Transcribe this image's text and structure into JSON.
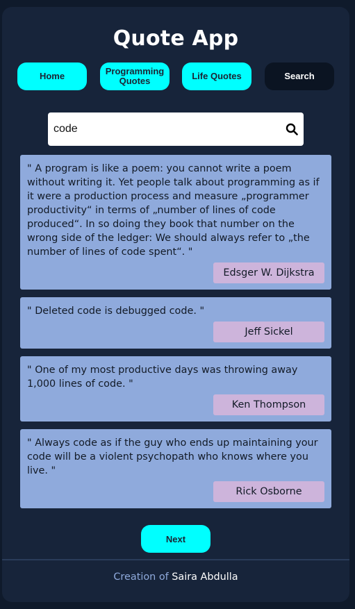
{
  "app": {
    "title": "Quote App"
  },
  "nav": {
    "items": [
      {
        "label": "Home"
      },
      {
        "label": "Programming\nQuotes"
      },
      {
        "label": "Life Quotes"
      },
      {
        "label": "Search"
      }
    ]
  },
  "search": {
    "value": "code",
    "placeholder": ""
  },
  "quotes": [
    {
      "text": "\" A program is like a poem: you cannot write a poem without writing it. Yet people talk about programming as if it were a production process and measure „programmer productivity“ in terms of „number of lines of code produced“. In so doing they book that number on the wrong side of the ledger: We should always refer to „the number of lines of code spent“. \"",
      "author": "Edsger W. Dijkstra"
    },
    {
      "text": "\" Deleted code is debugged code. \"",
      "author": "Jeff Sickel"
    },
    {
      "text": "\" One of my most productive days was throwing away 1,000 lines of code. \"",
      "author": "Ken Thompson"
    },
    {
      "text": "\" Always code as if the guy who ends up maintaining your code will be a violent psychopath who knows where you live. \"",
      "author": "Rick Osborne"
    }
  ],
  "pagination": {
    "next_label": "Next"
  },
  "footer": {
    "prefix": "Creation of",
    "name": "Saira Abdulla"
  },
  "colors": {
    "background": "#17243a",
    "accent": "#00ffff",
    "card": "#8faadc",
    "author_badge": "#cdb4db"
  }
}
